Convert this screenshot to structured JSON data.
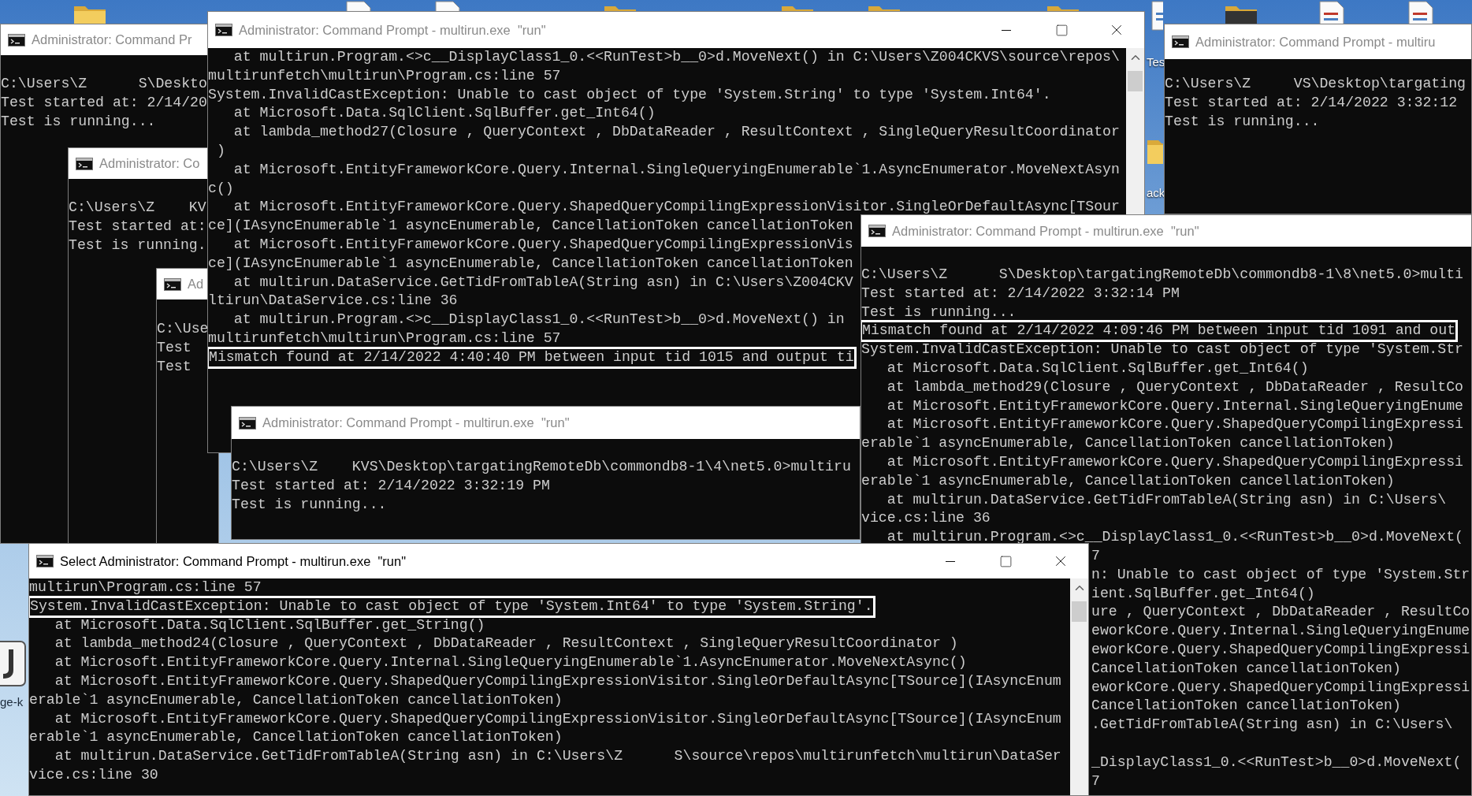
{
  "desktop": {
    "labels": [
      {
        "text": "Tes"
      },
      {
        "text": "ack"
      },
      {
        "text": "ge-k"
      }
    ]
  },
  "windows": [
    {
      "title": "Administrator: Command Pr",
      "active": false,
      "lines": [
        {
          "text": "C:\\Users\\Z      S\\Deskto",
          "highlighted": false
        },
        {
          "text": "Test started at: 2/14/20",
          "highlighted": false
        },
        {
          "text": "Test is running...",
          "highlighted": false
        }
      ]
    },
    {
      "title": "Administrator: Co",
      "active": false,
      "lines": [
        {
          "text": "C:\\Users\\Z    KV",
          "highlighted": false
        },
        {
          "text": "Test started at:",
          "highlighted": false
        },
        {
          "text": "Test is running.",
          "highlighted": false
        }
      ]
    },
    {
      "title": "Ad",
      "active": false,
      "lines": [
        {
          "text": "C:\\Use",
          "highlighted": false
        },
        {
          "text": "Test",
          "highlighted": false
        },
        {
          "text": "Test",
          "highlighted": false
        }
      ]
    },
    {
      "title": "Administrator: Command Prompt - multirun.exe  \"run\"",
      "active": false,
      "controls": true,
      "scrollbar": true,
      "lines": [
        {
          "text": "   at multirun.Program.<>c__DisplayClass1_0.<<RunTest>b__0>d.MoveNext() in C:\\Users\\Z004CKVS\\source\\repos\\",
          "highlighted": false
        },
        {
          "text": "multirunfetch\\multirun\\Program.cs:line 57",
          "highlighted": false
        },
        {
          "text": "System.InvalidCastException: Unable to cast object of type 'System.String' to type 'System.Int64'.",
          "highlighted": false
        },
        {
          "text": "   at Microsoft.Data.SqlClient.SqlBuffer.get_Int64()",
          "highlighted": false
        },
        {
          "text": "   at lambda_method27(Closure , QueryContext , DbDataReader , ResultContext , SingleQueryResultCoordinator",
          "highlighted": false
        },
        {
          "text": " )",
          "highlighted": false
        },
        {
          "text": "   at Microsoft.EntityFrameworkCore.Query.Internal.SingleQueryingEnumerable`1.AsyncEnumerator.MoveNextAsyn",
          "highlighted": false
        },
        {
          "text": "c()",
          "highlighted": false
        },
        {
          "text": "   at Microsoft.EntityFrameworkCore.Query.ShapedQueryCompilingExpressionVisitor.SingleOrDefaultAsync[TSour",
          "highlighted": false
        },
        {
          "text": "ce](IAsyncEnumerable`1 asyncEnumerable, CancellationToken cancellationToken",
          "highlighted": false
        },
        {
          "text": "   at Microsoft.EntityFrameworkCore.Query.ShapedQueryCompilingExpressionVis",
          "highlighted": false
        },
        {
          "text": "ce](IAsyncEnumerable`1 asyncEnumerable, CancellationToken cancellationToken",
          "highlighted": false
        },
        {
          "text": "   at multirun.DataService.GetTidFromTableA(String asn) in C:\\Users\\Z004CKV",
          "highlighted": false
        },
        {
          "text": "ltirun\\DataService.cs:line 36",
          "highlighted": false
        },
        {
          "text": "   at multirun.Program.<>c__DisplayClass1_0.<<RunTest>b__0>d.MoveNext() in",
          "highlighted": false
        },
        {
          "text": "multirunfetch\\multirun\\Program.cs:line 57",
          "highlighted": false
        },
        {
          "text": "Mismatch found at 2/14/2022 4:40:40 PM between input tid 1015 and output ti",
          "highlighted": true
        }
      ]
    },
    {
      "title": "Administrator: Command Prompt - multiru",
      "active": false,
      "lines": [
        {
          "text": "C:\\Users\\Z     VS\\Desktop\\targating",
          "highlighted": false
        },
        {
          "text": "Test started at: 2/14/2022 3:32:12",
          "highlighted": false
        },
        {
          "text": "Test is running...",
          "highlighted": false
        }
      ]
    },
    {
      "title": "Administrator: Command Prompt - multirun.exe  \"run\"",
      "active": false,
      "lines": [
        {
          "text": "C:\\Users\\Z      S\\Desktop\\targatingRemoteDb\\commondb8-1\\8\\net5.0>multi",
          "highlighted": false
        },
        {
          "text": "Test started at: 2/14/2022 3:32:14 PM",
          "highlighted": false
        },
        {
          "text": "Test is running...",
          "highlighted": false
        },
        {
          "text": "Mismatch found at 2/14/2022 4:09:46 PM between input tid 1091 and out",
          "highlighted": true
        },
        {
          "text": "System.InvalidCastException: Unable to cast object of type 'System.Str",
          "highlighted": false
        },
        {
          "text": "   at Microsoft.Data.SqlClient.SqlBuffer.get_Int64()",
          "highlighted": false
        },
        {
          "text": "   at lambda_method29(Closure , QueryContext , DbDataReader , ResultCo",
          "highlighted": false
        },
        {
          "text": "   at Microsoft.EntityFrameworkCore.Query.Internal.SingleQueryingEnume",
          "highlighted": false
        },
        {
          "text": "   at Microsoft.EntityFrameworkCore.Query.ShapedQueryCompilingExpressi",
          "highlighted": false
        },
        {
          "text": "erable`1 asyncEnumerable, CancellationToken cancellationToken)",
          "highlighted": false
        },
        {
          "text": "   at Microsoft.EntityFrameworkCore.Query.ShapedQueryCompilingExpressi",
          "highlighted": false
        },
        {
          "text": "erable`1 asyncEnumerable, CancellationToken cancellationToken)",
          "highlighted": false
        },
        {
          "text": "   at multirun.DataService.GetTidFromTableA(String asn) in C:\\Users\\",
          "highlighted": false
        },
        {
          "text": "vice.cs:line 36",
          "highlighted": false
        },
        {
          "text": "   at multirun.Program.<>c__DisplayClass1_0.<<RunTest>b__0>d.MoveNext(",
          "highlighted": false
        }
      ],
      "tail_lines": [
        {
          "kind": "text",
          "text": "7"
        },
        {
          "kind": "text",
          "text": "n: Unable to cast object of type 'System.Str"
        },
        {
          "kind": "text",
          "text": "ient.SqlBuffer.get_Int64()"
        },
        {
          "kind": "text",
          "text": "ure , QueryContext , DbDataReader , ResultCo"
        },
        {
          "kind": "text",
          "text": "eworkCore.Query.Internal.SingleQueryingEnume"
        },
        {
          "kind": "text",
          "text": "eworkCore.Query.ShapedQueryCompilingExpressi"
        },
        {
          "kind": "text",
          "text": "CancellationToken cancellationToken)"
        },
        {
          "kind": "text",
          "text": "eworkCore.Query.ShapedQueryCompilingExpressi"
        },
        {
          "kind": "text",
          "text": "CancellationToken cancellationToken)"
        },
        {
          "kind": "text",
          "text": ".GetTidFromTableA(String asn) in C:\\Users\\"
        },
        {
          "kind": "blank"
        },
        {
          "kind": "text",
          "text": "_DisplayClass1_0.<<RunTest>b__0>d.MoveNext("
        },
        {
          "kind": "text",
          "text": "7"
        }
      ]
    },
    {
      "title": "Administrator: Command Prompt - multirun.exe  \"run\"",
      "active": false,
      "lines": [
        {
          "text": "C:\\Users\\Z    KVS\\Desktop\\targatingRemoteDb\\commondb8-1\\4\\net5.0>multiru",
          "highlighted": false
        },
        {
          "text": "Test started at: 2/14/2022 3:32:19 PM",
          "highlighted": false
        },
        {
          "text": "Test is running...",
          "highlighted": false
        }
      ]
    },
    {
      "title": "Select Administrator: Command Prompt - multirun.exe  \"run\"",
      "active": true,
      "controls": true,
      "scrollbar": true,
      "lines": [
        {
          "text": "multirun\\Program.cs:line 57",
          "highlighted": false
        },
        {
          "text": "System.InvalidCastException: Unable to cast object of type 'System.Int64' to type 'System.String'.",
          "highlighted": true
        },
        {
          "text": "   at Microsoft.Data.SqlClient.SqlBuffer.get_String()",
          "highlighted": false
        },
        {
          "text": "   at lambda_method24(Closure , QueryContext , DbDataReader , ResultContext , SingleQueryResultCoordinator )",
          "highlighted": false
        },
        {
          "text": "   at Microsoft.EntityFrameworkCore.Query.Internal.SingleQueryingEnumerable`1.AsyncEnumerator.MoveNextAsync()",
          "highlighted": false
        },
        {
          "text": "   at Microsoft.EntityFrameworkCore.Query.ShapedQueryCompilingExpressionVisitor.SingleOrDefaultAsync[TSource](IAsyncEnum",
          "highlighted": false
        },
        {
          "text": "erable`1 asyncEnumerable, CancellationToken cancellationToken)",
          "highlighted": false
        },
        {
          "text": "   at Microsoft.EntityFrameworkCore.Query.ShapedQueryCompilingExpressionVisitor.SingleOrDefaultAsync[TSource](IAsyncEnum",
          "highlighted": false
        },
        {
          "text": "erable`1 asyncEnumerable, CancellationToken cancellationToken)",
          "highlighted": false
        },
        {
          "text": "   at multirun.DataService.GetTidFromTableA(String asn) in C:\\Users\\Z      S\\source\\repos\\multirunfetch\\multirun\\DataSer",
          "highlighted": false
        },
        {
          "text": "vice.cs:line 30",
          "highlighted": false
        }
      ]
    }
  ]
}
